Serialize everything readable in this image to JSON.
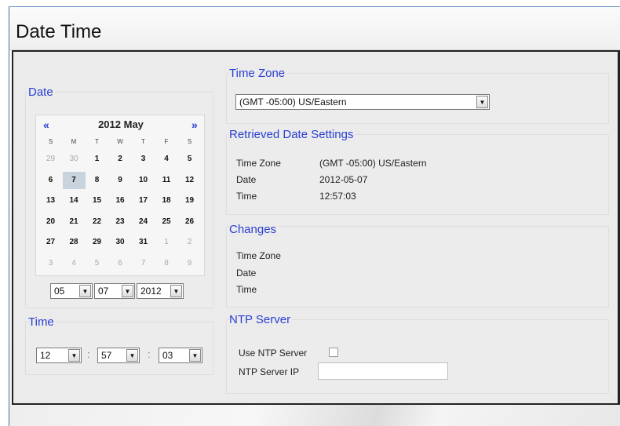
{
  "page": {
    "title": "Date Time"
  },
  "date_section": {
    "legend": "Date",
    "calendar": {
      "prev": "«",
      "next": "»",
      "title": "2012 May",
      "weekdays": [
        "S",
        "M",
        "T",
        "W",
        "T",
        "F",
        "S"
      ],
      "weeks": [
        [
          {
            "d": "29",
            "o": true
          },
          {
            "d": "30",
            "o": true
          },
          {
            "d": "1"
          },
          {
            "d": "2"
          },
          {
            "d": "3"
          },
          {
            "d": "4"
          },
          {
            "d": "5"
          }
        ],
        [
          {
            "d": "6"
          },
          {
            "d": "7",
            "sel": true
          },
          {
            "d": "8"
          },
          {
            "d": "9"
          },
          {
            "d": "10"
          },
          {
            "d": "11"
          },
          {
            "d": "12"
          }
        ],
        [
          {
            "d": "13"
          },
          {
            "d": "14"
          },
          {
            "d": "15"
          },
          {
            "d": "16"
          },
          {
            "d": "17"
          },
          {
            "d": "18"
          },
          {
            "d": "19"
          }
        ],
        [
          {
            "d": "20"
          },
          {
            "d": "21"
          },
          {
            "d": "22"
          },
          {
            "d": "23"
          },
          {
            "d": "24"
          },
          {
            "d": "25"
          },
          {
            "d": "26"
          }
        ],
        [
          {
            "d": "27"
          },
          {
            "d": "28"
          },
          {
            "d": "29"
          },
          {
            "d": "30"
          },
          {
            "d": "31"
          },
          {
            "d": "1",
            "o": true
          },
          {
            "d": "2",
            "o": true
          }
        ],
        [
          {
            "d": "3",
            "o": true
          },
          {
            "d": "4",
            "o": true
          },
          {
            "d": "5",
            "o": true
          },
          {
            "d": "6",
            "o": true
          },
          {
            "d": "7",
            "o": true
          },
          {
            "d": "8",
            "o": true
          },
          {
            "d": "9",
            "o": true
          }
        ]
      ]
    },
    "month_select": "05",
    "day_select": "07",
    "year_select": "2012"
  },
  "time_section": {
    "legend": "Time",
    "hour_select": "12",
    "minute_select": "57",
    "second_select": "03",
    "separator": ":"
  },
  "timezone_section": {
    "legend": "Time Zone",
    "selected": "(GMT -05:00) US/Eastern"
  },
  "retrieved_section": {
    "legend": "Retrieved Date Settings",
    "rows": [
      {
        "label": "Time Zone",
        "value": "(GMT -05:00) US/Eastern"
      },
      {
        "label": "Date",
        "value": "2012-05-07"
      },
      {
        "label": "Time",
        "value": "12:57:03"
      }
    ]
  },
  "changes_section": {
    "legend": "Changes",
    "rows": [
      {
        "label": "Time Zone",
        "value": ""
      },
      {
        "label": "Date",
        "value": ""
      },
      {
        "label": "Time",
        "value": ""
      }
    ]
  },
  "ntp_section": {
    "legend": "NTP Server",
    "use_label": "Use NTP Server",
    "use_checked": false,
    "ip_label": "NTP Server IP",
    "ip_value": ""
  },
  "colors": {
    "legend": "#2a3fd4",
    "selected_day": "#c9d3de"
  },
  "icons": {
    "dropdown": "triangle-down",
    "prev": "double-chevron-left",
    "next": "double-chevron-right"
  }
}
